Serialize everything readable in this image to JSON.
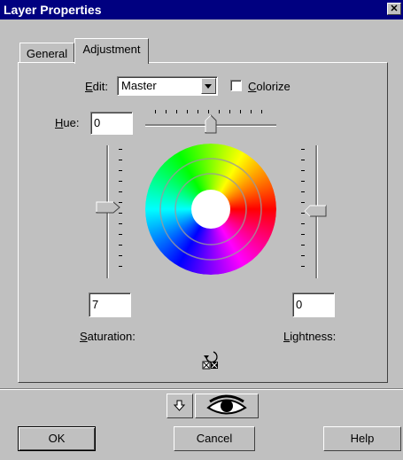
{
  "window": {
    "title": "Layer Properties",
    "close_glyph": "✕"
  },
  "tabs": [
    {
      "label": "General",
      "active": false
    },
    {
      "label": "Adjustment",
      "active": true
    }
  ],
  "edit": {
    "label_first": "E",
    "label_rest": "dit:",
    "value": "Master"
  },
  "colorize": {
    "label_first": "C",
    "label_rest": "olorize",
    "checked": false
  },
  "hue": {
    "label_first": "H",
    "label_rest": "ue:",
    "value": "0"
  },
  "saturation": {
    "label_first": "S",
    "label_rest": "aturation:",
    "value": "7"
  },
  "lightness": {
    "label_first": "L",
    "label_rest": "ightness:",
    "value": "0"
  },
  "reset_icon": "reset-undo-icon",
  "bottom_tools": {
    "arrow_icon": "arrow-down-icon",
    "eye_icon": "eye-icon"
  },
  "buttons": {
    "ok": "OK",
    "cancel": "Cancel",
    "help": "Help"
  }
}
